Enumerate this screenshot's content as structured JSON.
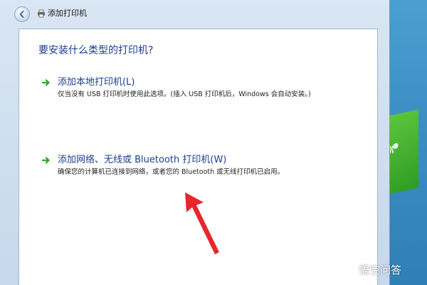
{
  "window": {
    "title": "添加打印机"
  },
  "page": {
    "heading": "要安装什么类型的打印机?"
  },
  "options": [
    {
      "title": "添加本地打印机(L)",
      "description": "仅当没有 USB 打印机时使用此选项。(插入 USB 打印机后，Windows 会自动安装。)"
    },
    {
      "title": "添加网络、无线或 Bluetooth 打印机(W)",
      "description": "确保您的计算机已连接到网络，或者您的 Bluetooth 或无线打印机已启用。"
    }
  ],
  "watermark": {
    "text": "悟空问答"
  },
  "icons": {
    "back": "back-arrow-icon",
    "printer": "printer-icon",
    "option_arrow": "green-right-arrow-icon",
    "annotation": "red-pointer-arrow",
    "watermark_logo": "chat-bubble-logo"
  },
  "colors": {
    "link_blue": "#1e3d8f",
    "option_arrow_green": "#2aa52a",
    "annotation_red": "#e8262b",
    "window_frame": "#c6d8ec"
  }
}
